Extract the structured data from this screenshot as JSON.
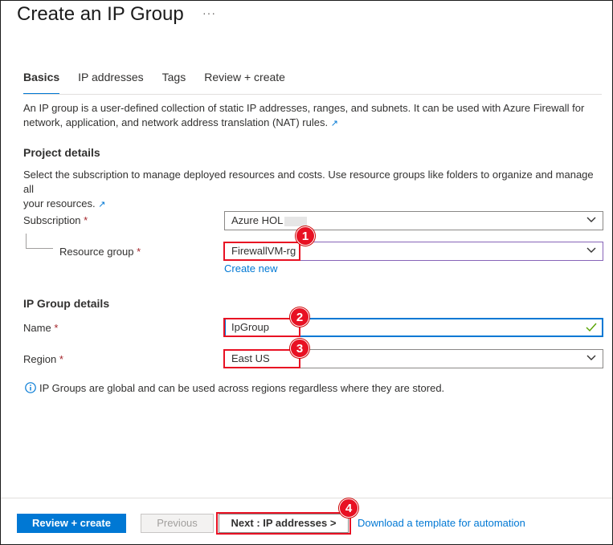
{
  "page": {
    "title": "Create an IP Group",
    "more_label": "···"
  },
  "tabs": [
    {
      "label": "Basics",
      "active": true
    },
    {
      "label": "IP addresses",
      "active": false
    },
    {
      "label": "Tags",
      "active": false
    },
    {
      "label": "Review + create",
      "active": false
    }
  ],
  "intro": {
    "line1": "An IP group is a user-defined collection of static IP addresses, ranges, and subnets. It can be used with Azure Firewall for",
    "line2": "network, application, and network address translation (NAT) rules."
  },
  "project": {
    "heading": "Project details",
    "desc_line1": "Select the subscription to manage deployed resources and costs. Use resource groups like folders to organize and manage all",
    "desc_line2": "your resources.",
    "subscription_label": "Subscription",
    "subscription_value": "Azure HOL",
    "resource_group_label": "Resource group",
    "resource_group_value": "FirewallVM-rg",
    "create_new": "Create new"
  },
  "ipgroup": {
    "heading": "IP Group details",
    "name_label": "Name",
    "name_value": "IpGroup",
    "region_label": "Region",
    "region_value": "East US",
    "info": "IP Groups are global and can be used across regions regardless where they are stored."
  },
  "required_mark": "*",
  "footer": {
    "review_create": "Review + create",
    "previous": "Previous",
    "next": "Next : IP addresses >",
    "download": "Download a template for automation"
  },
  "callouts": [
    "1",
    "2",
    "3",
    "4"
  ],
  "colors": {
    "accent": "#0078d4",
    "annotation_red": "#e81123",
    "required": "#a4262c"
  },
  "icons": {
    "external_link": "external-link-icon",
    "chevron": "chevron-down-icon",
    "check": "checkmark-icon",
    "info": "info-icon"
  }
}
